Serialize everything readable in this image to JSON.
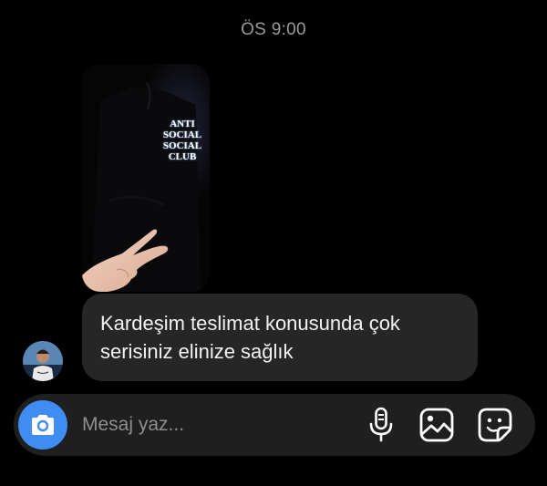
{
  "conversation": {
    "timestamp": "ÖS 9:00",
    "photo_message": {
      "shirt_print": [
        "ANTI",
        "SOCIAL",
        "SOCIAL",
        "CLUB"
      ]
    },
    "text_message": {
      "lines": [
        "Kardeşim teslimat konusunda çok",
        "serisiniz elinize sağlık"
      ]
    }
  },
  "composer": {
    "placeholder": "Mesaj yaz...",
    "icons": {
      "camera": "camera-icon",
      "mic": "microphone-icon",
      "gallery": "gallery-icon",
      "sticker": "sticker-icon"
    }
  },
  "colors": {
    "background": "#000000",
    "bubble": "#262626",
    "composer": "#1f1f1f",
    "camera_button": "#3f8cf2",
    "timestamp": "#9a9a9a"
  }
}
